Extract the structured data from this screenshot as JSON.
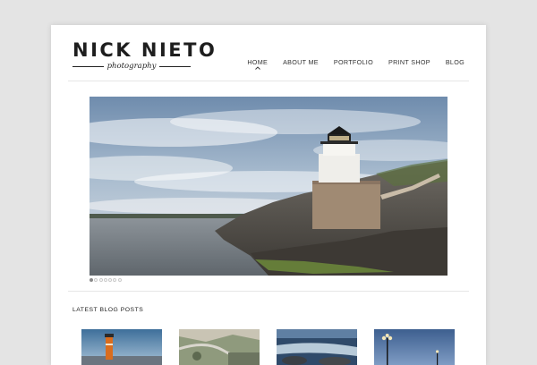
{
  "site": {
    "logo_name": "NICK NIETO",
    "logo_tagline": "photography"
  },
  "nav": {
    "items": [
      {
        "label": "HOME",
        "active": true
      },
      {
        "label": "ABOUT ME"
      },
      {
        "label": "PORTFOLIO"
      },
      {
        "label": "PRINT SHOP"
      },
      {
        "label": "BLOG"
      }
    ]
  },
  "slider": {
    "image": "lighthouse-on-rocky-shore-photo",
    "slide_count": 7,
    "current_slide": 1
  },
  "blog": {
    "section_title": "LATEST BLOG POSTS",
    "thumbnails": [
      {
        "image": "orange-lighthouse-photo"
      },
      {
        "image": "aerial-coastline-road-photo"
      },
      {
        "image": "rocky-stream-photo"
      },
      {
        "image": "street-lamp-dusk-photo"
      }
    ]
  },
  "colors": {
    "background": "#e4e4e4",
    "page": "#ffffff",
    "text": "#222222",
    "divider": "#e6e6e6",
    "dot_active": "#8a8a8a"
  }
}
